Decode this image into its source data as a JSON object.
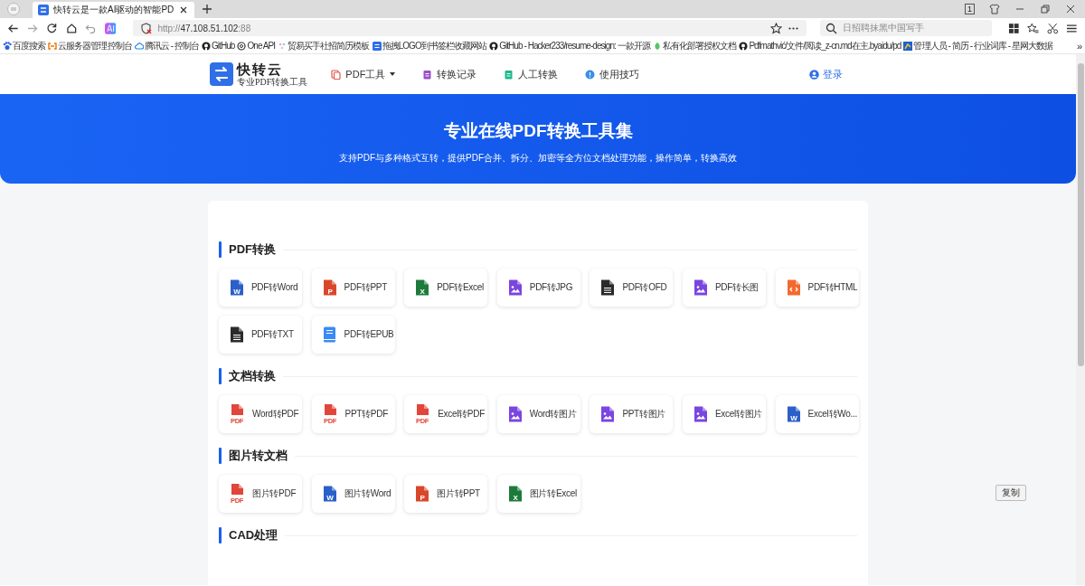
{
  "browser": {
    "tab": {
      "title": "快转云是一款AI驱动的智能PD",
      "selected": true
    },
    "tab_count": "1",
    "url": {
      "scheme": "http://",
      "host": "47.108.51.102",
      "port": ":88"
    },
    "search_placeholder": "日招聘抹黑中国写手",
    "bookmarks": [
      {
        "label": "百度搜索",
        "kind": "paw"
      },
      {
        "label": "云服务器管理控制台",
        "kind": "bracket"
      },
      {
        "label": "腾讯云 - 控制台",
        "kind": "cloud"
      },
      {
        "label": "GitHub",
        "kind": "github"
      },
      {
        "label": "One API",
        "kind": "knot"
      },
      {
        "label": "贸易买手社招简历模板",
        "kind": "dots"
      },
      {
        "label": "拖拽LOGO到书签栏收藏网站",
        "kind": "logo"
      },
      {
        "label": "GitHub - Hacker233/resume-design: 一款开源",
        "kind": "github"
      },
      {
        "label": "私有化部署授权文档",
        "kind": "leaf"
      },
      {
        "label": "Pdfmathvić/文件/阅读_z-cn.md在主.byaidu/pd",
        "kind": "github"
      },
      {
        "label": "管理人员 - 简历 - 行业词库 - 星网大数据",
        "kind": "chart"
      }
    ],
    "more": "»"
  },
  "header": {
    "logo_title": "快转云",
    "logo_subtitle": "专业PDF转换工具",
    "nav": [
      {
        "label": "PDF工具",
        "kind": "pdf",
        "dropdown": true
      },
      {
        "label": "转换记录",
        "kind": "record",
        "dropdown": false
      },
      {
        "label": "人工转换",
        "kind": "manual",
        "dropdown": false
      },
      {
        "label": "使用技巧",
        "kind": "info",
        "dropdown": false
      }
    ],
    "login": "登录"
  },
  "hero": {
    "title": "专业在线PDF转换工具集",
    "subtitle": "支持PDF与多种格式互转，提供PDF合并、拆分、加密等全方位文档处理功能，操作简单，转换高效"
  },
  "sections": [
    {
      "title": "PDF转换",
      "tools": [
        {
          "label": "PDF转Word",
          "kind": "word",
          "mark": "W"
        },
        {
          "label": "PDF转PPT",
          "kind": "ppt",
          "mark": "P"
        },
        {
          "label": "PDF转Excel",
          "kind": "excel",
          "mark": "X"
        },
        {
          "label": "PDF转JPG",
          "kind": "image"
        },
        {
          "label": "PDF转OFD",
          "kind": "text"
        },
        {
          "label": "PDF转长图",
          "kind": "image"
        },
        {
          "label": "PDF转HTML",
          "kind": "code"
        },
        {
          "label": "PDF转TXT",
          "kind": "text"
        },
        {
          "label": "PDF转EPUB",
          "kind": "book"
        }
      ]
    },
    {
      "title": "文档转换",
      "tools": [
        {
          "label": "Word转PDF",
          "kind": "pdf",
          "mark": "PDF"
        },
        {
          "label": "PPT转PDF",
          "kind": "pdf",
          "mark": "PDF"
        },
        {
          "label": "Excel转PDF",
          "kind": "pdf",
          "mark": "PDF"
        },
        {
          "label": "Word转图片",
          "kind": "image"
        },
        {
          "label": "PPT转图片",
          "kind": "image"
        },
        {
          "label": "Excel转图片",
          "kind": "image"
        },
        {
          "label": "Excel转Wo...",
          "kind": "word",
          "mark": "W"
        }
      ]
    },
    {
      "title": "图片转文档",
      "tools": [
        {
          "label": "图片转PDF",
          "kind": "pdf",
          "mark": "PDF"
        },
        {
          "label": "图片转Word",
          "kind": "word",
          "mark": "W"
        },
        {
          "label": "图片转PPT",
          "kind": "ppt",
          "mark": "P"
        },
        {
          "label": "图片转Excel",
          "kind": "excel",
          "mark": "X"
        }
      ]
    },
    {
      "title": "CAD处理"
    }
  ],
  "copy_button": "复制"
}
